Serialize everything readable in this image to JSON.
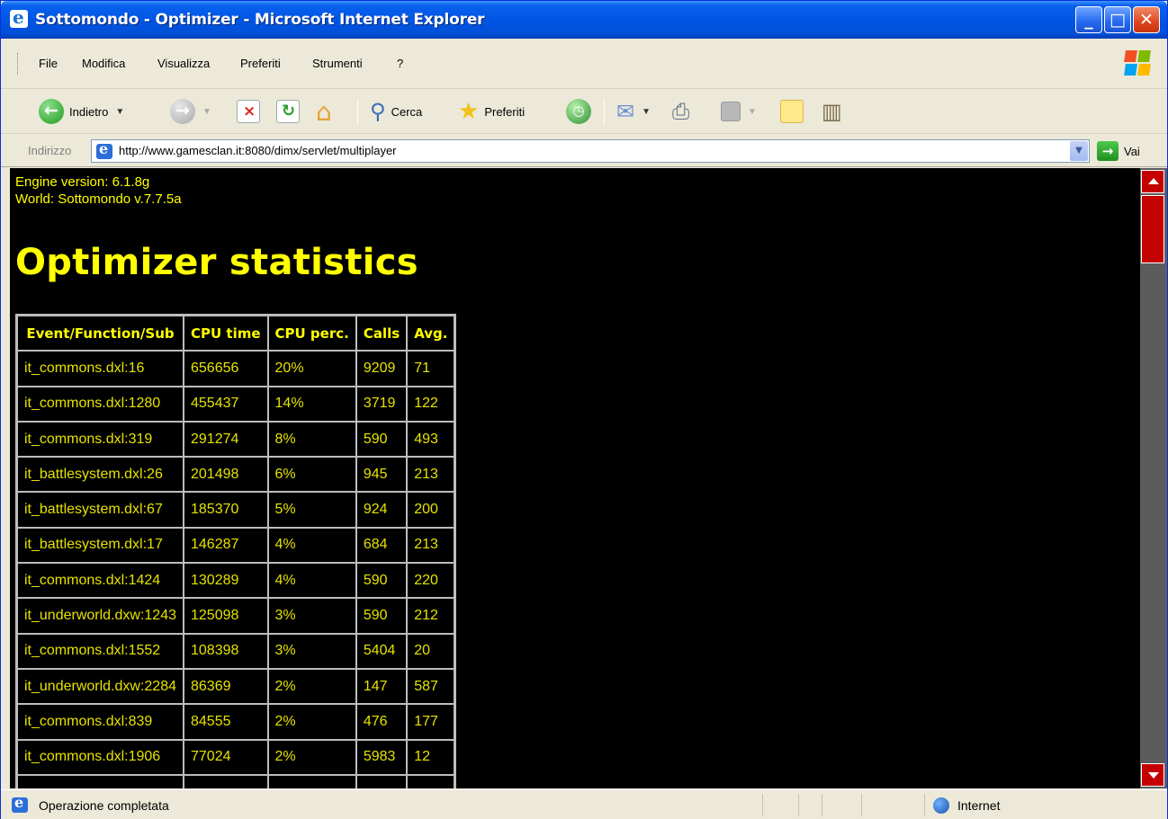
{
  "window": {
    "title": "Sottomondo - Optimizer - Microsoft Internet Explorer",
    "controls": {
      "minimize": "_",
      "maximize": "□",
      "close": "✕"
    }
  },
  "menu": [
    "File",
    "Modifica",
    "Visualizza",
    "Preferiti",
    "Strumenti",
    "?"
  ],
  "toolbar": {
    "back_label": "Indietro",
    "search_label": "Cerca",
    "favorites_label": "Preferiti"
  },
  "address": {
    "label": "Indirizzo",
    "url": "http://www.gamesclan.it:8080/dimx/servlet/multiplayer",
    "go_label": "Vai"
  },
  "page": {
    "engine_version": "Engine version: 6.1.8g",
    "world": "World: Sottomondo v.7.7.5a",
    "heading": "Optimizer statistics",
    "colors": {
      "background": "#000000",
      "text": "#ffff00"
    }
  },
  "table": {
    "headers": [
      "Event/Function/Sub",
      "CPU time",
      "CPU perc.",
      "Calls",
      "Avg."
    ],
    "rows": [
      [
        "it_commons.dxl:16",
        "656656",
        "20%",
        "9209",
        "71"
      ],
      [
        "it_commons.dxl:1280",
        "455437",
        "14%",
        "3719",
        "122"
      ],
      [
        "it_commons.dxl:319",
        "291274",
        "8%",
        "590",
        "493"
      ],
      [
        "it_battlesystem.dxl:26",
        "201498",
        "6%",
        "945",
        "213"
      ],
      [
        "it_battlesystem.dxl:67",
        "185370",
        "5%",
        "924",
        "200"
      ],
      [
        "it_battlesystem.dxl:17",
        "146287",
        "4%",
        "684",
        "213"
      ],
      [
        "it_commons.dxl:1424",
        "130289",
        "4%",
        "590",
        "220"
      ],
      [
        "it_underworld.dxw:1243",
        "125098",
        "3%",
        "590",
        "212"
      ],
      [
        "it_commons.dxl:1552",
        "108398",
        "3%",
        "5404",
        "20"
      ],
      [
        "it_underworld.dxw:2284",
        "86369",
        "2%",
        "147",
        "587"
      ],
      [
        "it_commons.dxl:839",
        "84555",
        "2%",
        "476",
        "177"
      ],
      [
        "it_commons.dxl:1906",
        "77024",
        "2%",
        "5983",
        "12"
      ],
      [
        "",
        "",
        "",
        "",
        ""
      ]
    ]
  },
  "status": {
    "text": "Operazione completata",
    "zone": "Internet"
  }
}
